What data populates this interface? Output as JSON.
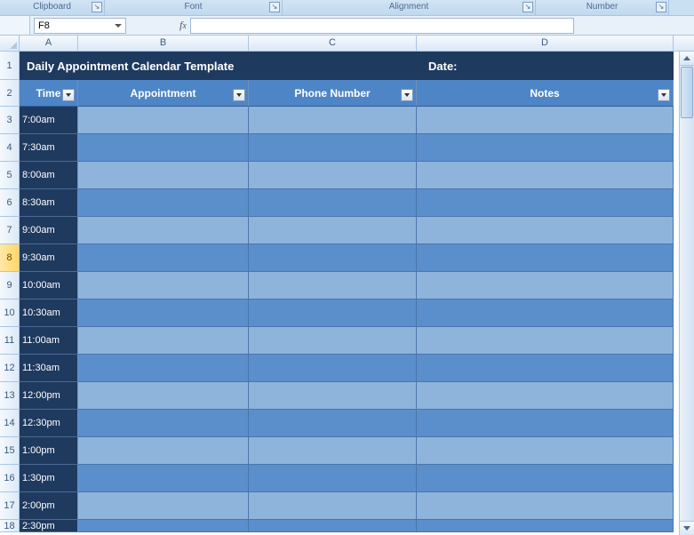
{
  "ribbon": {
    "groups": [
      "Clipboard",
      "Font",
      "Alignment",
      "Number"
    ]
  },
  "namebox": {
    "value": "F8"
  },
  "formula": {
    "value": ""
  },
  "columns": [
    "A",
    "B",
    "C",
    "D"
  ],
  "row_numbers": [
    "1",
    "2",
    "3",
    "4",
    "5",
    "6",
    "7",
    "8",
    "9",
    "10",
    "11",
    "12",
    "13",
    "14",
    "15",
    "16",
    "17",
    "18"
  ],
  "selected_row_index": 7,
  "title_row": {
    "text": "Daily Appointment Calendar Template",
    "date_label": "Date:"
  },
  "filter_row": {
    "time": "Time",
    "appointment": "Appointment",
    "phone": "Phone Number",
    "notes": "Notes"
  },
  "data_rows": [
    {
      "time": "7:00am",
      "appointment": "",
      "phone": "",
      "notes": ""
    },
    {
      "time": "7:30am",
      "appointment": "",
      "phone": "",
      "notes": ""
    },
    {
      "time": "8:00am",
      "appointment": "",
      "phone": "",
      "notes": ""
    },
    {
      "time": "8:30am",
      "appointment": "",
      "phone": "",
      "notes": ""
    },
    {
      "time": "9:00am",
      "appointment": "",
      "phone": "",
      "notes": ""
    },
    {
      "time": "9:30am",
      "appointment": "",
      "phone": "",
      "notes": ""
    },
    {
      "time": "10:00am",
      "appointment": "",
      "phone": "",
      "notes": ""
    },
    {
      "time": "10:30am",
      "appointment": "",
      "phone": "",
      "notes": ""
    },
    {
      "time": "11:00am",
      "appointment": "",
      "phone": "",
      "notes": ""
    },
    {
      "time": "11:30am",
      "appointment": "",
      "phone": "",
      "notes": ""
    },
    {
      "time": "12:00pm",
      "appointment": "",
      "phone": "",
      "notes": ""
    },
    {
      "time": "12:30pm",
      "appointment": "",
      "phone": "",
      "notes": ""
    },
    {
      "time": "1:00pm",
      "appointment": "",
      "phone": "",
      "notes": ""
    },
    {
      "time": "1:30pm",
      "appointment": "",
      "phone": "",
      "notes": ""
    },
    {
      "time": "2:00pm",
      "appointment": "",
      "phone": "",
      "notes": ""
    },
    {
      "time": "2:30pm",
      "appointment": "",
      "phone": "",
      "notes": ""
    }
  ]
}
